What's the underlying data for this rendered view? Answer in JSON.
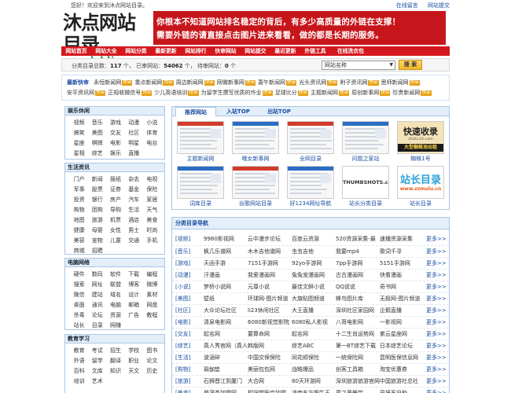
{
  "topbar": {
    "welcome": "您好！欢迎来到沐点网站目录。",
    "links": [
      "在线留言",
      "网站提交"
    ]
  },
  "logo": {
    "name": "沐点网站目录",
    "url": "www.bddir.cn"
  },
  "banner": {
    "line1": "你根本不知道网站排名稳定的背后，有多少高质量的外链在支撑！",
    "line2": "需要外链的请直接点击图片进来看看，做的都是长期的服务。",
    "colors": {
      "bg": "#c7161b",
      "text": "#ffffff"
    }
  },
  "nav": {
    "items": [
      "网站首页",
      "网站大全",
      "网站分类",
      "最新更新",
      "网站排行",
      "快审网站",
      "网站提交",
      "最近更新",
      "外链工具",
      "在线洗衣包"
    ],
    "color": "#d4171d"
  },
  "stats": {
    "label_total": "分类目录总数：",
    "total": "117",
    "unit1": "个",
    "label_included": "已审网站：",
    "included": "54062",
    "unit2": "个",
    "label_pending": "待审网站：",
    "pending": "0",
    "unit3": "个",
    "search_select": "网站名称",
    "search_button": "搜 索"
  },
  "latest": {
    "heading": "最新快审",
    "tag": "快审",
    "rows": [
      [
        "永恒新闻网",
        "重点新闻网",
        "周边新闻网",
        "网微新事网",
        "蔷午新闻网",
        "光头资讯网",
        "附子资讯网",
        "思师新闻网"
      ],
      [
        "安平资讯网",
        "正规收微信号",
        "少儿英语培训",
        "为留学生撰写优质的作业",
        "足球比分",
        "主题新闻网",
        "原创新事网",
        "珍贵新闻网"
      ]
    ]
  },
  "left_panels": [
    {
      "title": "娱乐休闲",
      "items": [
        "视频",
        "音乐",
        "游戏",
        "动漫",
        "小说",
        "搞笑",
        "美图",
        "交友",
        "社区",
        "体育",
        "星座",
        "棋牌",
        "电影",
        "明星",
        "电台",
        "星相",
        "综艺",
        "娱乐",
        "直播"
      ]
    },
    {
      "title": "生活资讯",
      "items": [
        "门户",
        "新闻",
        "报纸",
        "杂志",
        "电视",
        "军事",
        "股票",
        "证券",
        "基金",
        "保险",
        "投资",
        "银行",
        "房产",
        "汽车",
        "家居",
        "购物",
        "团购",
        "导购",
        "生活",
        "天气",
        "地图",
        "旅游",
        "机票",
        "酒店",
        "美食",
        "健康",
        "母婴",
        "女性",
        "男士",
        "时尚",
        "美容",
        "宠物",
        "儿童",
        "交通",
        "手机",
        "商城",
        "招聘"
      ]
    },
    {
      "title": "电脑网络",
      "items": [
        "硬件",
        "数码",
        "软件",
        "下载",
        "编程",
        "搜索",
        "网址",
        "联盟",
        "博客",
        "微博",
        "微信",
        "建站",
        "域名",
        "设计",
        "素材",
        "桌面",
        "通讯",
        "电脑",
        "邮箱",
        "网盘",
        "杀毒",
        "论坛",
        "资源",
        "广告",
        "教程",
        "站长",
        "目录",
        "网赚"
      ]
    },
    {
      "title": "教育学习",
      "items": [
        "教育",
        "考试",
        "招生",
        "学校",
        "图书",
        "外语",
        "留学",
        "翻译",
        "职业",
        "论文",
        "百科",
        "文库",
        "知识",
        "天文",
        "历史",
        "培训",
        "艺术"
      ]
    }
  ],
  "tabs": {
    "labels": [
      "推荐网站",
      "入站TOP",
      "出站TOP"
    ],
    "active": 0
  },
  "featured": [
    {
      "caption": "主题新闻网",
      "thumb": "news-site"
    },
    {
      "caption": "哦女新事网",
      "thumb": "news-site"
    },
    {
      "caption": "全网目录",
      "thumb": "directory"
    },
    {
      "caption": "问题之家站",
      "thumb": "forum"
    },
    {
      "caption": "蜘蛛1号",
      "thumb": "kuaisu-shoulu",
      "thumb_title": "快速收录",
      "thumb_sub": "大型蜘蛛池出租",
      "thumb_url": "zhizhu1h.com"
    },
    {
      "caption": "词库目录",
      "thumb": "directory"
    },
    {
      "caption": "谷歌网站目录",
      "thumb": "directory"
    },
    {
      "caption": "好1234网址导航",
      "thumb": "nav-site"
    },
    {
      "caption": "站长分类目录",
      "thumb": "thumbshots",
      "thumb_title": "THUMBSHOTS.com"
    },
    {
      "caption": "站长目录",
      "thumb": "zzmulu",
      "thumb_title": "站长目录",
      "thumb_url": "www.zzmulu.cn"
    }
  ],
  "category_nav": {
    "title": "分类目录导航",
    "more": "更多>>",
    "rows": [
      {
        "cat": "[视频]",
        "items": [
          "9980影视网",
          "云中漫步论坛",
          "百度云资源",
          "520资源采集-最",
          "速播资源采集"
        ]
      },
      {
        "cat": "[音乐]",
        "items": [
          "枫几乐谱网",
          "木木吉他谱网",
          "虫虫吉他",
          "我要mp4",
          "歌词千寻"
        ]
      },
      {
        "cat": "[游戏]",
        "items": [
          "天函手游",
          "7151手游网",
          "92yo手游网",
          "7pp手游网",
          "5151手游网"
        ]
      },
      {
        "cat": "[动漫]",
        "items": [
          "汗漫画",
          "我爱漫画网",
          "兔兔宠漫画网",
          "古古漫画网",
          "快看漫画"
        ]
      },
      {
        "cat": "[小说]",
        "items": [
          "梦桥小说网",
          "元尊小说",
          "最佳文鲜小说",
          "QQ说说",
          "奇书网"
        ]
      },
      {
        "cat": "[美图]",
        "items": [
          "壁纸",
          "环球网-图片频道",
          "大旗贴图频道",
          "蜂鸟图片库",
          "无极网-图片频道"
        ]
      },
      {
        "cat": "[社区]",
        "items": [
          "大众论坛社区",
          "li23休闲社区",
          "大王直播",
          "深圳社区家园网",
          "企鹅直播"
        ]
      },
      {
        "cat": "[电影]",
        "items": [
          "清泉电影网",
          "6080新视觉影院",
          "6080私人影视",
          "八哥电影网",
          "一影视网"
        ]
      },
      {
        "cat": "[交友]",
        "items": [
          "起名网",
          "要算命网",
          "起名网",
          "十二生肖运势网",
          "紫云星座网"
        ]
      },
      {
        "cat": "[综艺]",
        "items": [
          "真人秀官网（真人",
          "韩版网",
          "综艺ABC",
          "第一BT综艺下载",
          "日本综艺论坛"
        ]
      },
      {
        "cat": "[生活]",
        "items": [
          "波涵碎",
          "中国交保保险",
          "同花顺保险",
          "一统保险网",
          "昆明医保信息网"
        ]
      },
      {
        "cat": "[购物]",
        "items": [
          "瑜伽垫",
          "美丽包包网",
          "战略爆品",
          "创客工具箱",
          "淘宝优惠券"
        ]
      },
      {
        "cat": "[旅游]",
        "items": [
          "石狮晋江到厦门",
          "大合网",
          "80天环游网",
          "深圳旅游旅游官网",
          "中国旅游社总社"
        ]
      },
      {
        "cat": "[美食]",
        "items": [
          "普洱茶加盟网",
          "相润堂医疗加盟",
          "济南东方肥牛王",
          "君之藤餐饮",
          "巴将军自助"
        ]
      }
    ]
  }
}
